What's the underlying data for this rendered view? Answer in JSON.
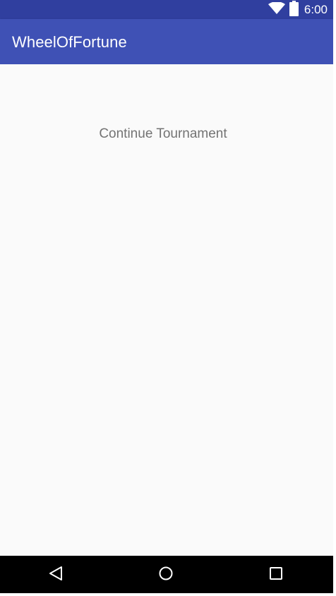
{
  "status_bar": {
    "time": "6:00",
    "icons": [
      "wifi-icon",
      "battery-icon"
    ],
    "color": "#303f9f"
  },
  "app_bar": {
    "title": "WheelOfFortune",
    "color": "#3f51b5"
  },
  "main": {
    "continue_label": "Continue Tournament",
    "background": "#fafafa"
  },
  "nav_bar": {
    "buttons": [
      "back-icon",
      "home-icon",
      "recents-icon"
    ]
  }
}
